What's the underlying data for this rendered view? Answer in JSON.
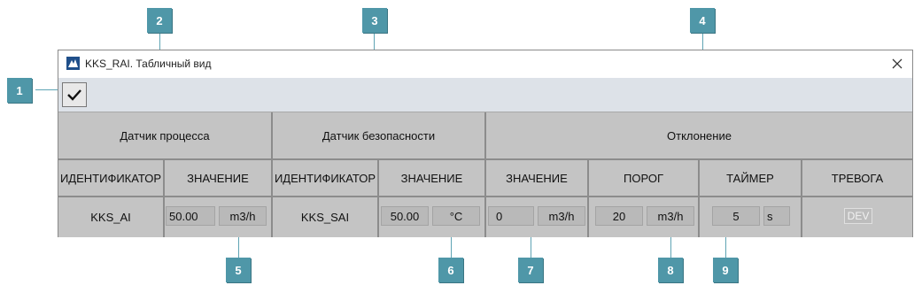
{
  "window": {
    "title": "KKS_RAI. Табличный вид"
  },
  "header": {
    "process_sensor": "Датчик процесса",
    "safety_sensor": "Датчик безопасности",
    "deviation": "Отклонение"
  },
  "columns": {
    "process_id": "ИДЕНТИФИКАТОР",
    "process_value": "ЗНАЧЕНИЕ",
    "safety_id": "ИДЕНТИФИКАТОР",
    "safety_value": "ЗНАЧЕНИЕ",
    "dev_value": "ЗНАЧЕНИЕ",
    "threshold": "ПОРОГ",
    "timer": "ТАЙМЕР",
    "alarm": "ТРЕВОГА"
  },
  "row": {
    "process_id": "KKS_AI",
    "process_value": "50.00",
    "process_unit": "m3/h",
    "safety_id": "KKS_SAI",
    "safety_value": "50.00",
    "safety_unit": "°C",
    "dev_value": "0",
    "dev_unit": "m3/h",
    "threshold_value": "20",
    "threshold_unit": "m3/h",
    "timer_value": "5",
    "timer_unit": "s",
    "alarm": "DEV"
  },
  "callouts": [
    "1",
    "2",
    "3",
    "4",
    "5",
    "6",
    "7",
    "8",
    "9"
  ],
  "icons": {
    "app": "app-logo-icon",
    "close": "close-icon",
    "apply": "checkmark-icon"
  },
  "colors": {
    "callout": "#4f97a8",
    "grid": "#c4c4c4",
    "toolbar": "#dde2e8"
  }
}
